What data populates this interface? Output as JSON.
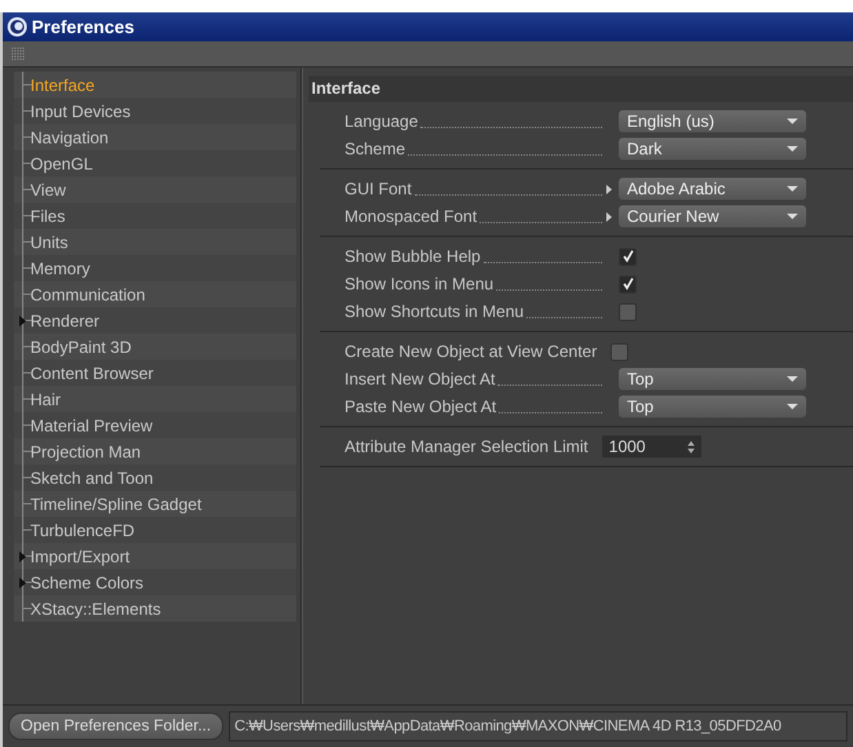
{
  "window": {
    "title": "Preferences"
  },
  "sidebar": {
    "items": [
      {
        "label": "Interface",
        "selected": true,
        "expandable": false
      },
      {
        "label": "Input Devices",
        "selected": false,
        "expandable": false
      },
      {
        "label": "Navigation",
        "selected": false,
        "expandable": false
      },
      {
        "label": "OpenGL",
        "selected": false,
        "expandable": false
      },
      {
        "label": "View",
        "selected": false,
        "expandable": false
      },
      {
        "label": "Files",
        "selected": false,
        "expandable": false
      },
      {
        "label": "Units",
        "selected": false,
        "expandable": false
      },
      {
        "label": "Memory",
        "selected": false,
        "expandable": false
      },
      {
        "label": "Communication",
        "selected": false,
        "expandable": false
      },
      {
        "label": "Renderer",
        "selected": false,
        "expandable": true
      },
      {
        "label": "BodyPaint 3D",
        "selected": false,
        "expandable": false
      },
      {
        "label": "Content Browser",
        "selected": false,
        "expandable": false
      },
      {
        "label": "Hair",
        "selected": false,
        "expandable": false
      },
      {
        "label": "Material Preview",
        "selected": false,
        "expandable": false
      },
      {
        "label": "Projection Man",
        "selected": false,
        "expandable": false
      },
      {
        "label": "Sketch and Toon",
        "selected": false,
        "expandable": false
      },
      {
        "label": "Timeline/Spline Gadget",
        "selected": false,
        "expandable": false
      },
      {
        "label": "TurbulenceFD",
        "selected": false,
        "expandable": false
      },
      {
        "label": "Import/Export",
        "selected": false,
        "expandable": true
      },
      {
        "label": "Scheme Colors",
        "selected": false,
        "expandable": true
      },
      {
        "label": "XStacy::Elements",
        "selected": false,
        "expandable": false
      }
    ]
  },
  "panel": {
    "title": "Interface",
    "groups": [
      [
        {
          "kind": "dropdown",
          "label": "Language",
          "value": "English (us)",
          "leader": true,
          "submenu": false
        },
        {
          "kind": "dropdown",
          "label": "Scheme",
          "value": "Dark",
          "leader": true,
          "submenu": false
        }
      ],
      [
        {
          "kind": "dropdown",
          "label": "GUI Font",
          "value": "Adobe Arabic",
          "leader": true,
          "submenu": true
        },
        {
          "kind": "dropdown",
          "label": "Monospaced Font",
          "value": "Courier New",
          "leader": true,
          "submenu": true
        }
      ],
      [
        {
          "kind": "checkbox",
          "label": "Show Bubble Help",
          "checked": true,
          "leader": true
        },
        {
          "kind": "checkbox",
          "label": "Show Icons in Menu",
          "checked": true,
          "leader": true
        },
        {
          "kind": "checkbox",
          "label": "Show Shortcuts in Menu",
          "checked": false,
          "leader": true
        }
      ],
      [
        {
          "kind": "checkbox",
          "label": "Create New Object at View Center",
          "checked": false,
          "leader": false
        },
        {
          "kind": "dropdown",
          "label": "Insert New Object At",
          "value": "Top",
          "leader": true,
          "submenu": false
        },
        {
          "kind": "dropdown",
          "label": "Paste New Object At",
          "value": "Top",
          "leader": true,
          "submenu": false
        }
      ],
      [
        {
          "kind": "number",
          "label": "Attribute Manager Selection Limit",
          "value": "1000",
          "leader": false
        }
      ]
    ]
  },
  "footer": {
    "button": "Open Preferences Folder...",
    "path": "C:₩Users₩medillust₩AppData₩Roaming₩MAXON₩CINEMA 4D R13_05DFD2A0"
  }
}
